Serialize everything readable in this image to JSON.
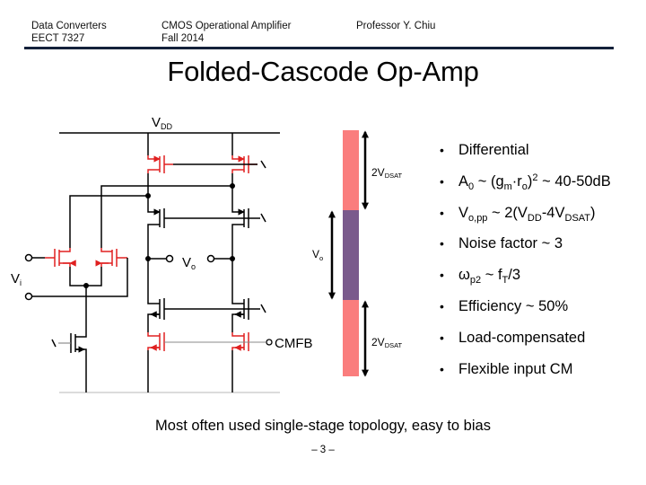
{
  "header": {
    "course_name": "Data Converters",
    "course_code": "EECT 7327",
    "topic": "CMOS Operational Amplifier",
    "term": "Fall 2014",
    "instructor": "Professor Y. Chiu"
  },
  "slide": {
    "title": "Folded-Cascode Op-Amp",
    "caption": "Most often used single-stage topology, easy to bias",
    "page_number": "– 3 –"
  },
  "circuit": {
    "supply_label": "V",
    "supply_sub": "DD",
    "output_label": "V",
    "output_sub": "o",
    "input_label": "V",
    "input_sub": "i",
    "cmfb_label": "CMFB",
    "colors": {
      "highlight_transistor": "#e02020",
      "wire": "#000000"
    }
  },
  "swing_bar": {
    "top_segment_label": "2V",
    "top_segment_sub": "DSAT",
    "middle_segment_label": "V",
    "middle_segment_sub": "o",
    "bottom_segment_label": "2V",
    "bottom_segment_sub": "DSAT",
    "colors": {
      "headroom": "#fa7d7d",
      "swing": "#7a5a8c"
    }
  },
  "bullets": [
    {
      "parts": [
        [
          "t",
          "Differential"
        ]
      ]
    },
    {
      "parts": [
        [
          "t",
          "A"
        ],
        [
          "sub",
          "0"
        ],
        [
          "t",
          " ~ (g"
        ],
        [
          "sub",
          "m"
        ],
        [
          "t",
          "·r"
        ],
        [
          "sub",
          "o"
        ],
        [
          "t",
          ")"
        ],
        [
          "sup",
          "2"
        ],
        [
          "t",
          " ~ 40-50dB"
        ]
      ]
    },
    {
      "parts": [
        [
          "t",
          "V"
        ],
        [
          "sub",
          "o,pp"
        ],
        [
          "t",
          " ~ 2(V"
        ],
        [
          "sub",
          "DD"
        ],
        [
          "t",
          "-4V"
        ],
        [
          "sub",
          "DSAT"
        ],
        [
          "t",
          ")"
        ]
      ]
    },
    {
      "parts": [
        [
          "t",
          "Noise factor ~ 3"
        ]
      ]
    },
    {
      "parts": [
        [
          "t",
          "ω"
        ],
        [
          "sub",
          "p2"
        ],
        [
          "t",
          " ~ f"
        ],
        [
          "sub",
          "T"
        ],
        [
          "t",
          "/3"
        ]
      ]
    },
    {
      "parts": [
        [
          "t",
          "Efficiency ~ 50%"
        ]
      ]
    },
    {
      "parts": [
        [
          "t",
          "Load-compensated"
        ]
      ]
    },
    {
      "parts": [
        [
          "t",
          "Flexible input CM"
        ]
      ]
    }
  ],
  "bullet_glyph": "•"
}
